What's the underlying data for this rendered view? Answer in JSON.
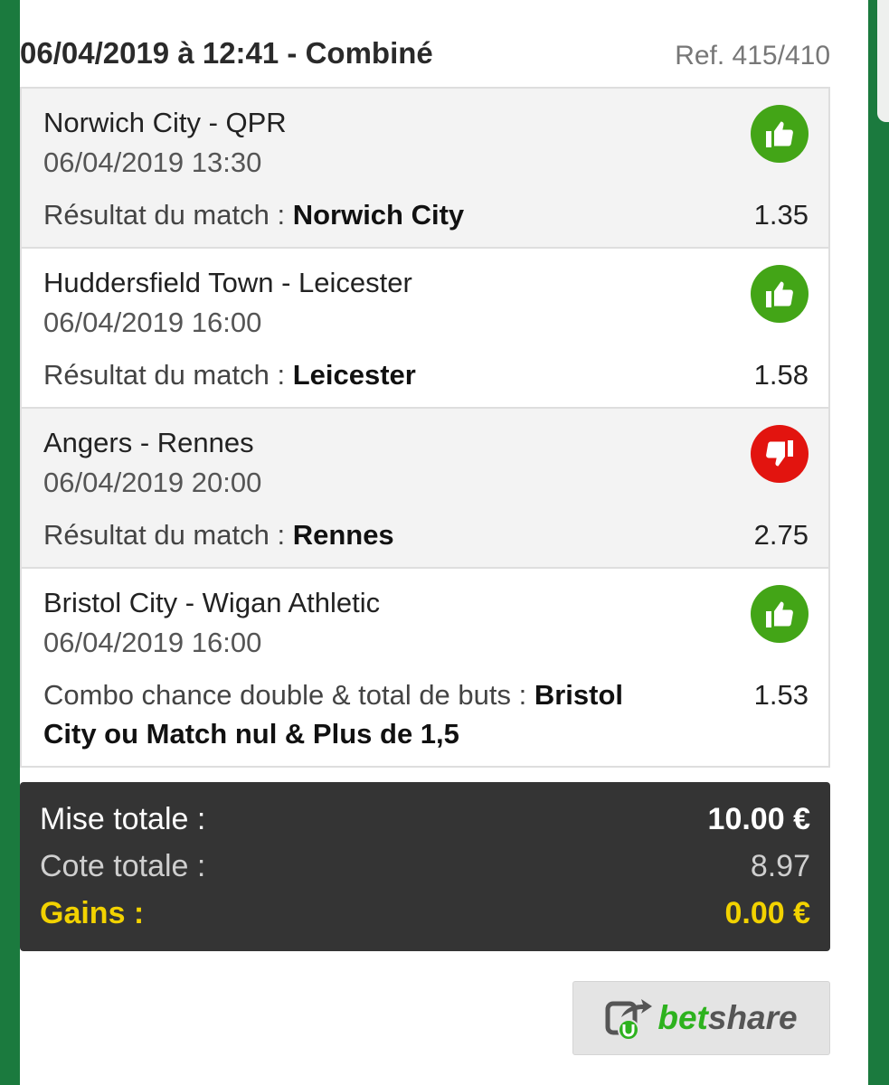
{
  "header": {
    "title": "06/04/2019 à 12:41 - Combiné",
    "ref": "Ref. 415/410"
  },
  "bets": [
    {
      "teams": "Norwich City - QPR",
      "date": "06/04/2019 13:30",
      "market": "Résultat du match : ",
      "selection": "Norwich City",
      "odds": "1.35",
      "result": "won",
      "result_icon": "thumbs-up-icon",
      "result_color": "#43a517"
    },
    {
      "teams": "Huddersfield Town - Leicester",
      "date": "06/04/2019 16:00",
      "market": "Résultat du match : ",
      "selection": "Leicester",
      "odds": "1.58",
      "result": "won",
      "result_icon": "thumbs-up-icon",
      "result_color": "#43a517"
    },
    {
      "teams": "Angers - Rennes",
      "date": "06/04/2019 20:00",
      "market": "Résultat du match : ",
      "selection": "Rennes",
      "odds": "2.75",
      "result": "lost",
      "result_icon": "thumbs-down-icon",
      "result_color": "#e2140f"
    },
    {
      "teams": "Bristol City - Wigan Athletic",
      "date": "06/04/2019 16:00",
      "market": "Combo chance double & total de buts : ",
      "selection": "Bristol City ou Match nul & Plus de 1,5",
      "odds": "1.53",
      "result": "won",
      "result_icon": "thumbs-up-icon",
      "result_color": "#43a517"
    }
  ],
  "summary": {
    "stake_label": "Mise totale :",
    "stake_value": "10.00 €",
    "odds_label": "Cote totale :",
    "odds_value": "8.97",
    "gains_label": "Gains :",
    "gains_value": "0.00 €",
    "gains_color": "#f2d200"
  },
  "share_button": {
    "word_bet": "bet",
    "word_share": "share",
    "icon": "betshare-logo-icon",
    "brand_color": "#2db21e"
  }
}
